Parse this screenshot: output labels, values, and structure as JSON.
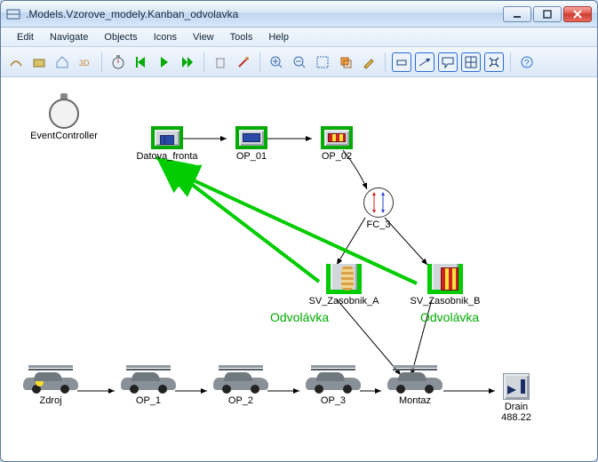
{
  "window": {
    "title": ".Models.Vzorove_modely.Kanban_odvolavka"
  },
  "menu": {
    "items": [
      "Edit",
      "Navigate",
      "Objects",
      "Icons",
      "View",
      "Tools",
      "Help"
    ]
  },
  "nodes": {
    "event_controller": "EventController",
    "datova_fronta": "Datova_fronta",
    "op01": "OP_01",
    "op02": "OP_02",
    "fc3": "FC_3",
    "sv_a": "SV_Zasobnik_A",
    "sv_b": "SV_Zasobnik_B",
    "odvolavka_a": "Odvolávka",
    "odvolavka_b": "Odvolávka",
    "zdroj": "Zdroj",
    "op1": "OP_1",
    "op2": "OP_2",
    "op3": "OP_3",
    "montaz": "Montaz",
    "drain": "Drain",
    "drain_val": "488.22"
  }
}
